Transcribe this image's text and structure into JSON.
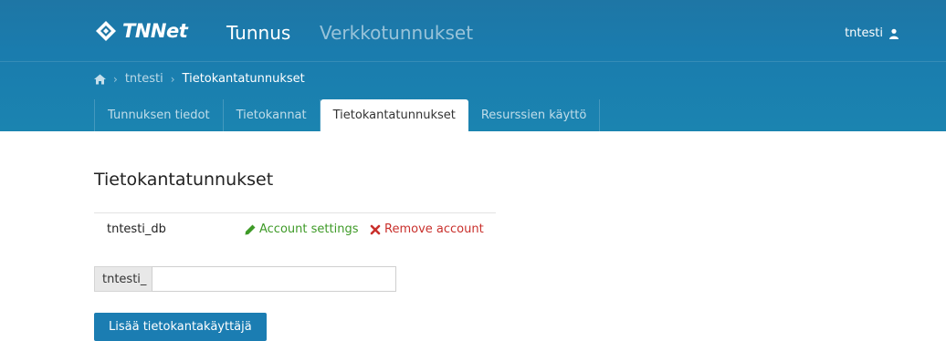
{
  "header": {
    "logo_text": "TNNet",
    "brand": "Tunnus",
    "nav_link": "Verkkotunnukset",
    "user": "tntesti",
    "colors": {
      "header_bg": "#1b7db2",
      "accent": "#1b7db2"
    }
  },
  "breadcrumb": {
    "home_icon": "home-icon",
    "items": [
      "tntesti",
      "Tietokantatunnukset"
    ]
  },
  "tabs": [
    {
      "label": "Tunnuksen tiedot",
      "active": false
    },
    {
      "label": "Tietokannat",
      "active": false
    },
    {
      "label": "Tietokantatunnukset",
      "active": true
    },
    {
      "label": "Resurssien käyttö",
      "active": false
    }
  ],
  "main": {
    "title": "Tietokantatunnukset",
    "accounts": [
      {
        "name": "tntesti_db",
        "settings_label": "Account settings",
        "remove_label": "Remove account"
      }
    ],
    "new_account": {
      "prefix": "tntesti_",
      "value": "",
      "placeholder": ""
    },
    "add_button": "Lisää tietokantakäyttäjä"
  }
}
